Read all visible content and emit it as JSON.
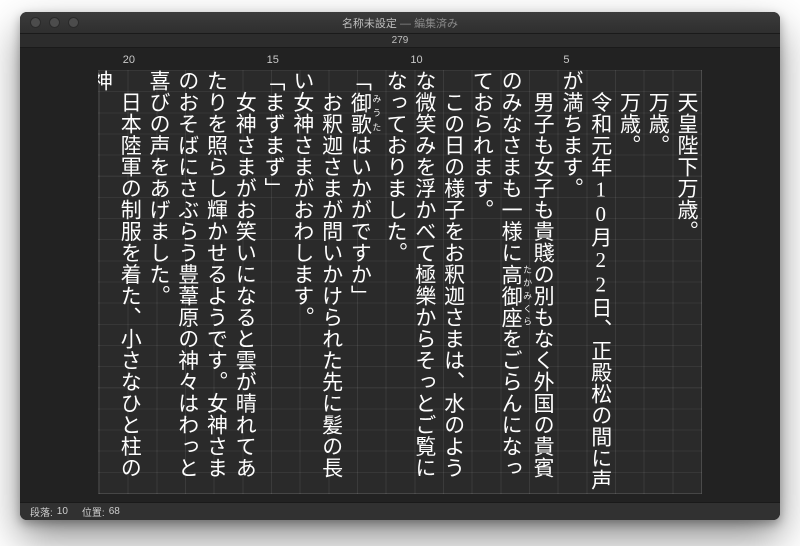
{
  "window": {
    "title_main": "名称未設定",
    "title_sub": "編集済み",
    "ruler_center": "279"
  },
  "ruler": {
    "marks": [
      {
        "label": "5",
        "col": 5
      },
      {
        "label": "10",
        "col": 10
      },
      {
        "label": "15",
        "col": 15
      },
      {
        "label": "20",
        "col": 20
      }
    ],
    "total_cols": 21
  },
  "body_lines": [
    "　天皇陛下万歳。",
    "　万歳。",
    "　万歳。",
    "　令和元年10月22日、正殿松の間に声が満ちます。",
    "　男子も女子も貴賤の別もなく外国の貴賓のみなさまも一様に高御座をごらんになっておられます。",
    "　この日の様子をお釈迦さまは、水のような微笑みを浮かべて極樂からそっとご覧になっておりました。",
    "「御歌はいかがですか」",
    "　お釈迦さまが問いかけられた先に髪の長い女神さまがおわします。",
    "「まずまず」",
    "　女神さまがお笑いになると雲が晴れてあたりを照らし輝かせるようです。女神さまのおそばにさぶらう豊葦原の神々はわっと喜びの声をあげました。",
    "　日本陸軍の制服を着た、小さなひと柱の神"
  ],
  "ruby": {
    "高御座": "たかみくら",
    "御歌": "みうた"
  },
  "status": {
    "para_label": "段落:",
    "para_value": "10",
    "pos_label": "位置:",
    "pos_value": "68"
  }
}
